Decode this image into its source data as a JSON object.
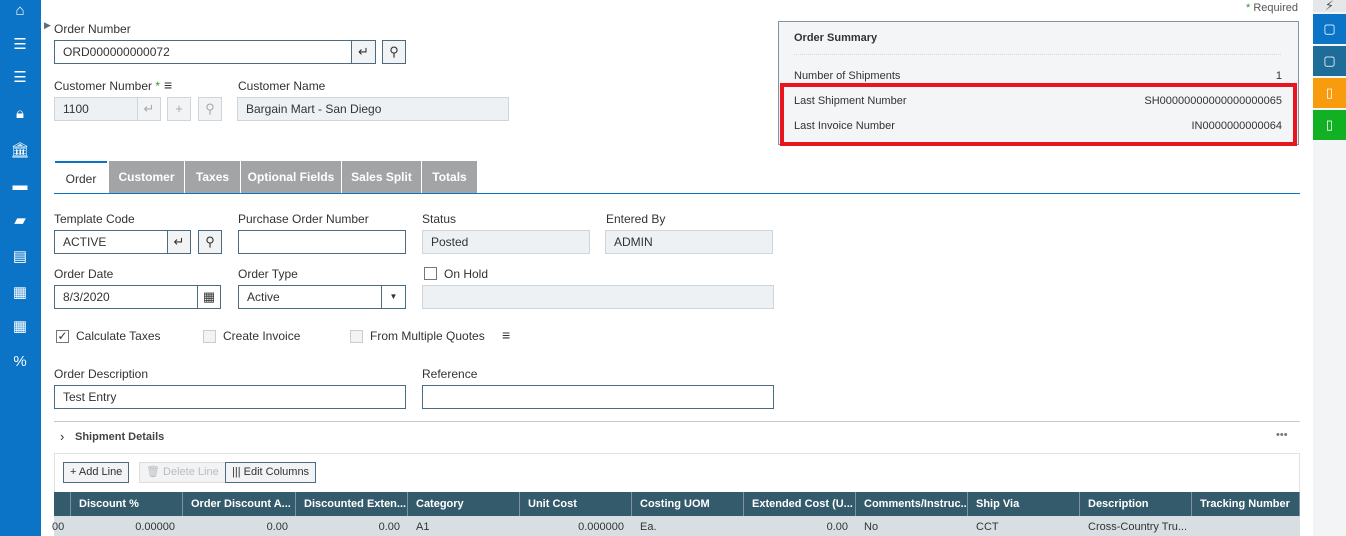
{
  "required_label": "Required",
  "header": {
    "order_number_label": "Order Number",
    "order_number": "ORD000000000072",
    "customer_number_label": "Customer Number",
    "customer_number": "1100",
    "customer_name_label": "Customer Name",
    "customer_name": "Bargain Mart - San Diego"
  },
  "summary": {
    "title": "Order Summary",
    "rows": [
      {
        "label": "Number of Shipments",
        "value": "1"
      },
      {
        "label": "Last Shipment Number",
        "value": "SH00000000000000000065"
      },
      {
        "label": "Last Invoice Number",
        "value": "IN0000000000064"
      }
    ],
    "highlight_color": "#e8141e"
  },
  "tabs": [
    "Order",
    "Customer",
    "Taxes",
    "Optional Fields",
    "Sales Split",
    "Totals"
  ],
  "active_tab": "Order",
  "form": {
    "template_code_label": "Template Code",
    "template_code": "ACTIVE",
    "po_label": "Purchase Order Number",
    "po": "",
    "status_label": "Status",
    "status": "Posted",
    "entered_by_label": "Entered By",
    "entered_by": "ADMIN",
    "order_date_label": "Order Date",
    "order_date": "8/3/2020",
    "order_type_label": "Order Type",
    "order_type": "Active",
    "on_hold_label": "On Hold",
    "on_hold": false,
    "on_hold_reason": "",
    "calc_taxes_label": "Calculate Taxes",
    "calc_taxes": true,
    "create_invoice_label": "Create Invoice",
    "create_invoice": false,
    "multi_quotes_label": "From Multiple Quotes",
    "multi_quotes": false,
    "description_label": "Order Description",
    "description": "Test Entry",
    "reference_label": "Reference",
    "reference": ""
  },
  "shipment": {
    "title": "Shipment Details",
    "add_line": "Add Line",
    "delete_line": "Delete Line",
    "edit_columns": "Edit Columns",
    "columns": [
      "",
      "Discount %",
      "Order Discount A...",
      "Discounted Exten...",
      "Category",
      "Unit Cost",
      "Costing UOM",
      "Extended Cost (U...",
      "Comments/Instruc...",
      "Ship Via",
      "Description",
      "Tracking Number"
    ],
    "row": [
      "00",
      "0.00000",
      "0.00",
      "0.00",
      "A1",
      "0.000000",
      "Ea.",
      "0.00",
      "No",
      "CCT",
      "Cross-Country Tru...",
      ""
    ]
  },
  "colors": {
    "nav": "#0b74c6",
    "table_header": "#335b6b",
    "accent": "#0b74c6"
  }
}
